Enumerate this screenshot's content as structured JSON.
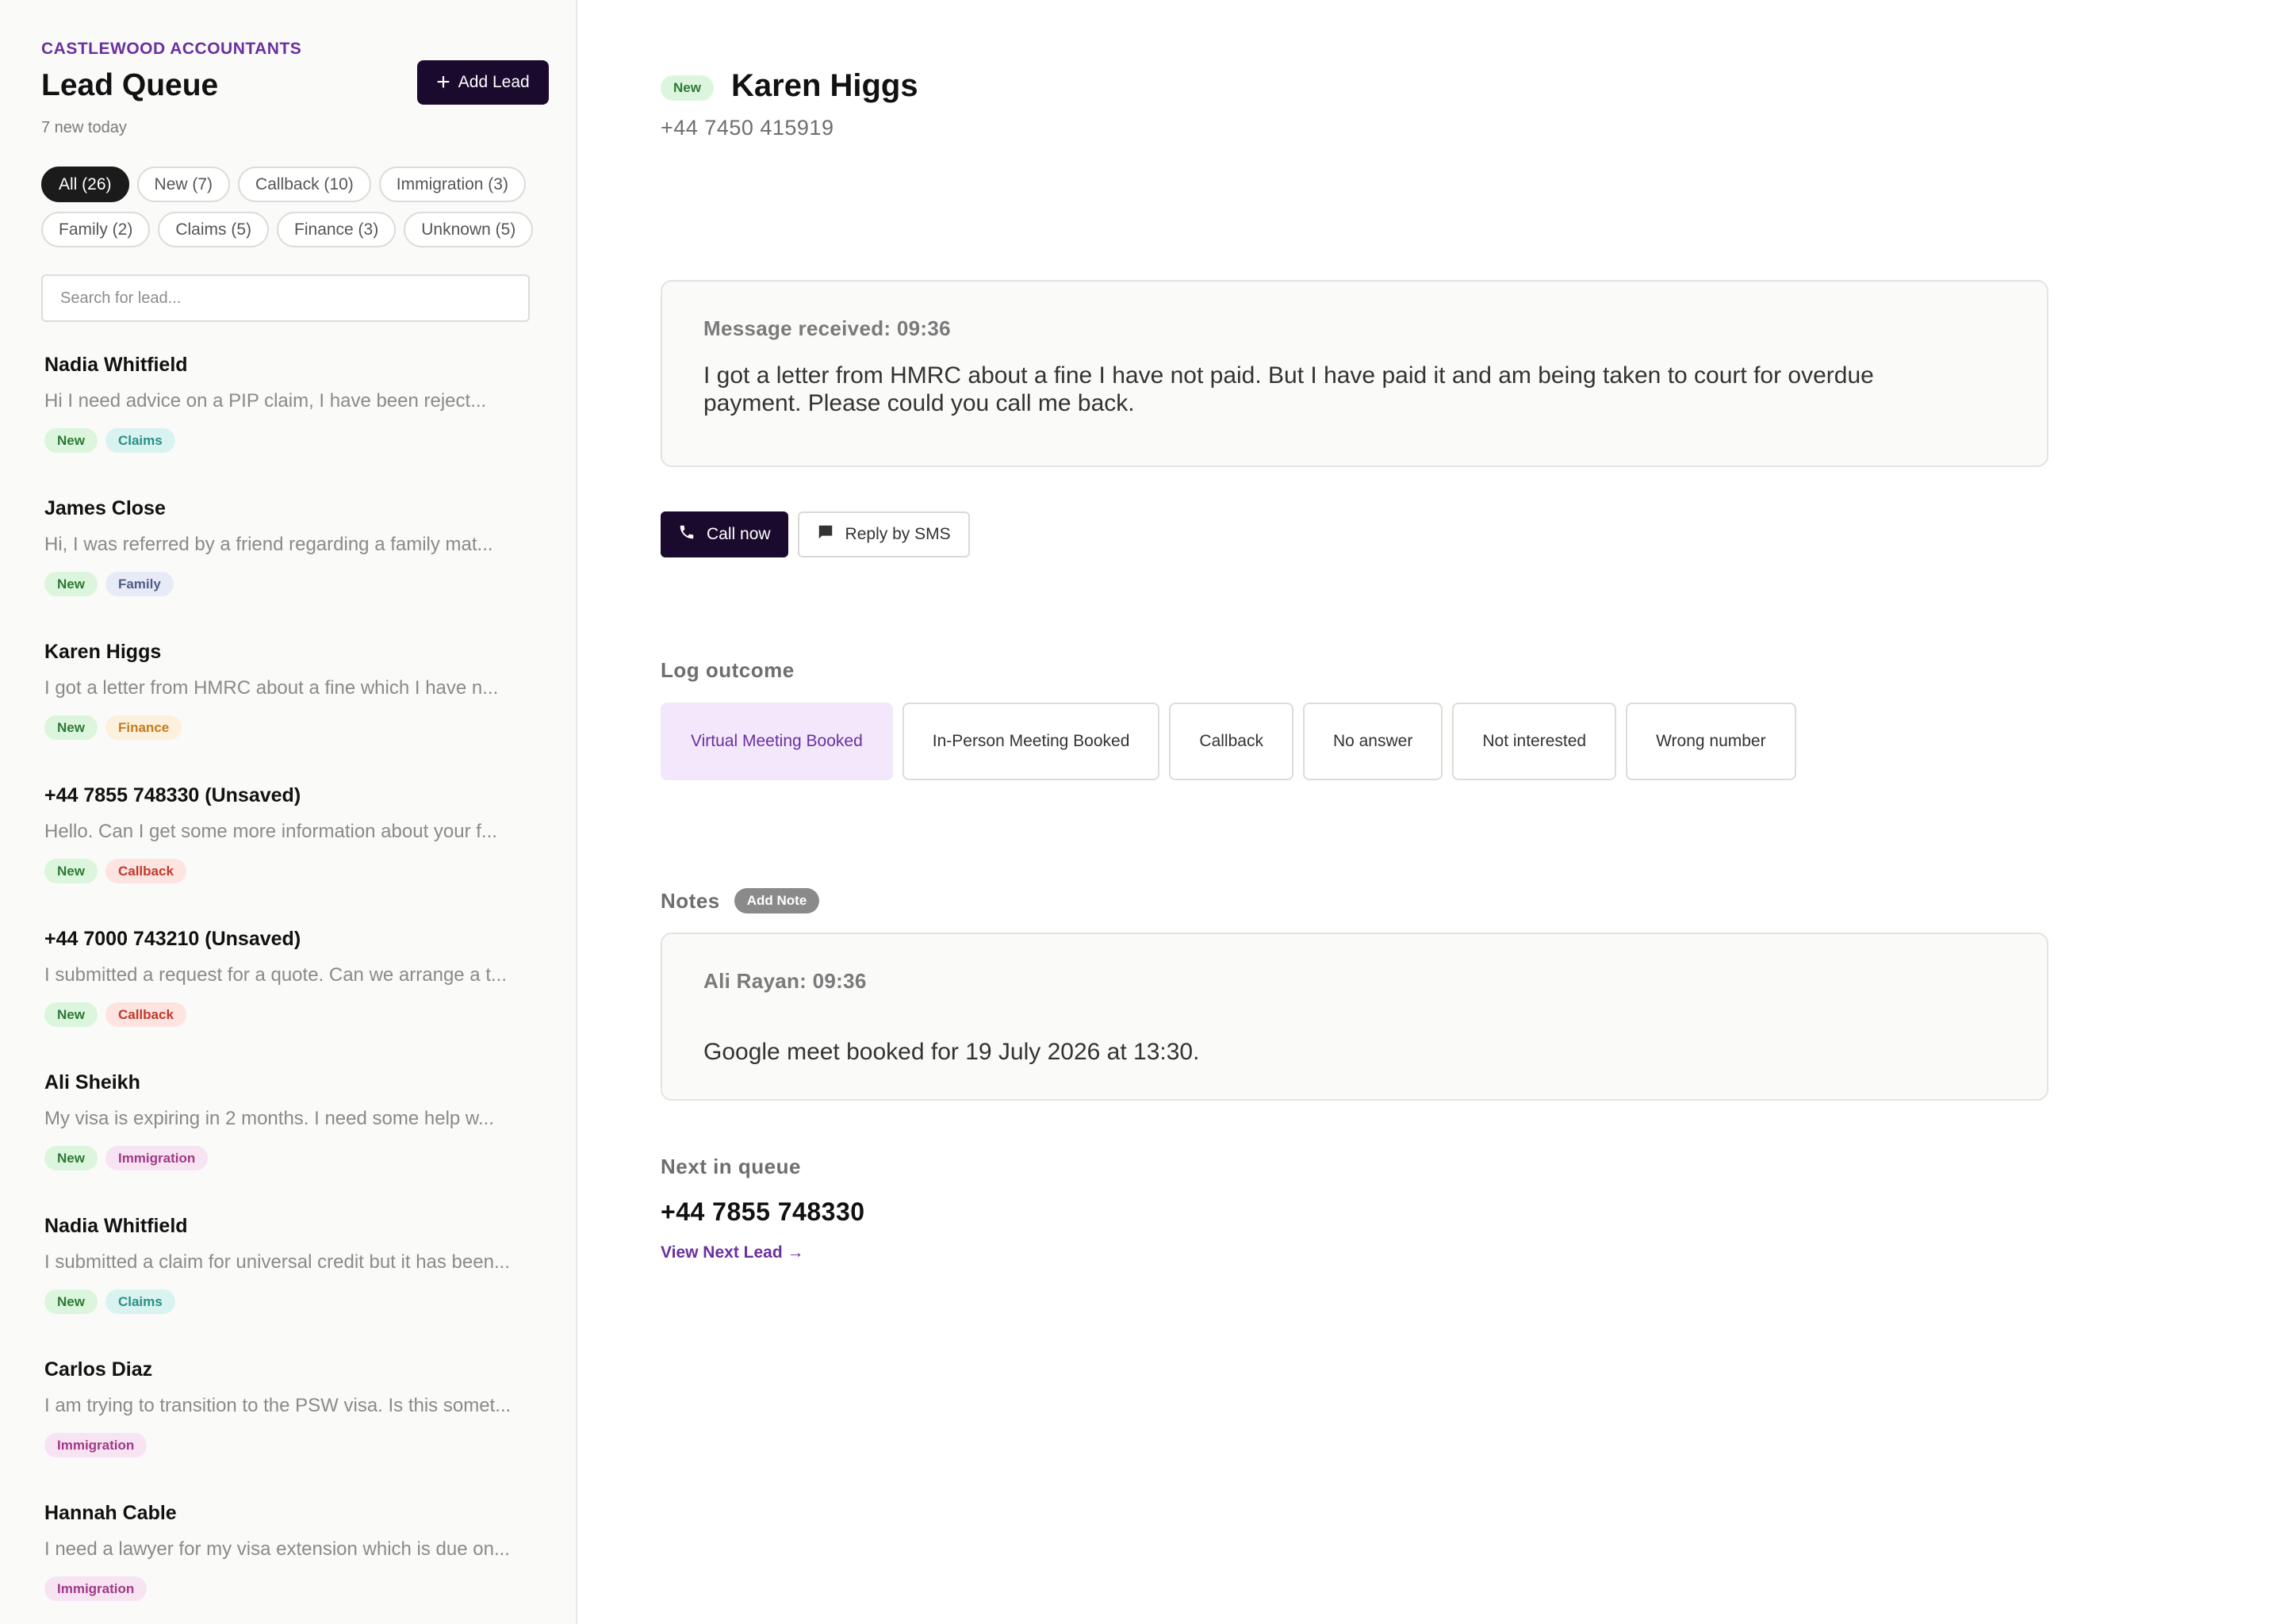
{
  "sidebar": {
    "firm_name": "CASTLEWOOD ACCOUNTANTS",
    "title": "Lead Queue",
    "subtitle": "7 new today",
    "add_lead_label": "Add Lead",
    "filters": [
      "All (26)",
      "New (7)",
      "Callback (10)",
      "Immigration (3)",
      "Family (2)",
      "Claims (5)",
      "Finance (3)",
      "Unknown (5)"
    ],
    "active_filter": "All (26)",
    "search_placeholder": "Search for lead...",
    "leads": [
      {
        "name": "Nadia Whitfield",
        "preview": "Hi I need advice on a PIP claim, I have been reject...",
        "tags": [
          {
            "label": "New",
            "kind": "new"
          },
          {
            "label": "Claims",
            "kind": "claims"
          }
        ]
      },
      {
        "name": "James Close",
        "preview": "Hi, I was referred by a friend regarding a family mat...",
        "tags": [
          {
            "label": "New",
            "kind": "new"
          },
          {
            "label": "Family",
            "kind": "family"
          }
        ]
      },
      {
        "name": "Karen Higgs",
        "preview": "I got a letter from HMRC about a fine which I have n...",
        "tags": [
          {
            "label": "New",
            "kind": "new"
          },
          {
            "label": "Finance",
            "kind": "finance"
          }
        ]
      },
      {
        "name": "+44 7855 748330 (Unsaved)",
        "preview": "Hello. Can I get some more information about your f...",
        "tags": [
          {
            "label": "New",
            "kind": "new"
          },
          {
            "label": "Callback",
            "kind": "callback"
          }
        ]
      },
      {
        "name": "+44 7000 743210 (Unsaved)",
        "preview": "I submitted a request for a quote. Can we arrange a t...",
        "tags": [
          {
            "label": "New",
            "kind": "new"
          },
          {
            "label": "Callback",
            "kind": "callback"
          }
        ]
      },
      {
        "name": "Ali Sheikh",
        "preview": "My visa is expiring in 2 months. I need some help w...",
        "tags": [
          {
            "label": "New",
            "kind": "new"
          },
          {
            "label": "Immigration",
            "kind": "immigration"
          }
        ]
      },
      {
        "name": "Nadia Whitfield",
        "preview": "I submitted a claim for universal credit but it has been...",
        "tags": [
          {
            "label": "New",
            "kind": "new"
          },
          {
            "label": "Claims",
            "kind": "claims"
          }
        ]
      },
      {
        "name": "Carlos Diaz",
        "preview": "I am trying to transition to the PSW visa. Is this somet...",
        "tags": [
          {
            "label": "Immigration",
            "kind": "immigration"
          }
        ]
      },
      {
        "name": "Hannah Cable",
        "preview": "I need a lawyer for my visa extension which is due on...",
        "tags": [
          {
            "label": "Immigration",
            "kind": "immigration"
          }
        ]
      }
    ]
  },
  "detail": {
    "status": "New",
    "name": "Karen Higgs",
    "phone": "+44 7450 415919",
    "message_label": "Message received: 09:36",
    "message_text": "I got a letter from HMRC about a fine I have not paid. But I have paid it and am being taken to court for overdue payment. Please could you call me back.",
    "call_label": "Call now",
    "sms_label": "Reply by SMS",
    "log_outcome_label": "Log outcome",
    "outcomes": [
      "Virtual Meeting Booked",
      "In-Person Meeting Booked",
      "Callback",
      "No answer",
      "Not interested",
      "Wrong number"
    ],
    "selected_outcome": "Virtual Meeting Booked",
    "notes_label": "Notes",
    "add_note_label": "Add Note",
    "note": {
      "author_time": "Ali Rayan: 09:36",
      "text": "Google meet booked for 19 July 2026 at 13:30."
    },
    "next_label": "Next in queue",
    "next_number": "+44 7855 748330",
    "next_link": "View Next Lead →"
  },
  "icons": {
    "add": "plus-icon",
    "call": "phone-icon",
    "sms": "message-icon"
  },
  "colors": {
    "brand_purple": "#6b2fa0",
    "primary_dark": "#1a0b2e",
    "selected_outcome_bg": "#f3e8fb"
  }
}
